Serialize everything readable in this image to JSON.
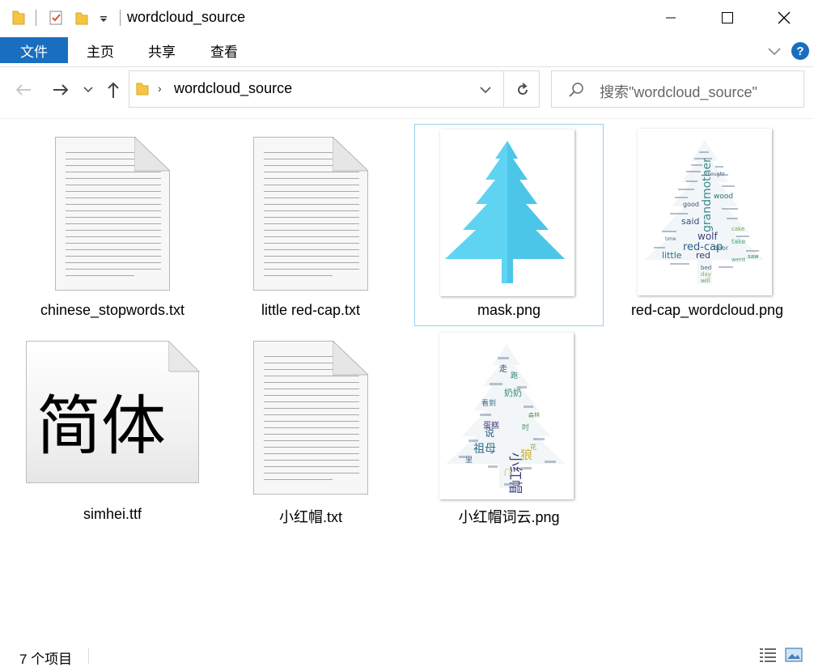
{
  "window": {
    "title": "wordcloud_source"
  },
  "ribbon": {
    "file_tab": "文件",
    "tabs": [
      "主页",
      "共享",
      "查看"
    ],
    "help_label": "?"
  },
  "address": {
    "path": "wordcloud_source",
    "separator": "›"
  },
  "search": {
    "placeholder": "搜索\"wordcloud_source\""
  },
  "files": [
    {
      "name": "chinese_stopwords.txt",
      "type": "text"
    },
    {
      "name": "little red-cap.txt",
      "type": "text"
    },
    {
      "name": "mask.png",
      "type": "image",
      "selected": true
    },
    {
      "name": "red-cap_wordcloud.png",
      "type": "image"
    },
    {
      "name": "simhei.ttf",
      "type": "font",
      "glyphs": "简体"
    },
    {
      "name": "小红帽.txt",
      "type": "text"
    },
    {
      "name": "小红帽词云.png",
      "type": "image"
    }
  ],
  "thumbnails": {
    "red_cap_words": [
      "grandmother",
      "red-cap",
      "wolf",
      "little",
      "red",
      "said",
      "wood",
      "good",
      "door",
      "take",
      "will",
      "bed",
      "day",
      "saw",
      "went",
      "cake",
      "thought",
      "time"
    ],
    "chinese_words": [
      "小红帽",
      "祖母",
      "狼",
      "奶奶",
      "说",
      "走",
      "跑",
      "蛋糕",
      "看到",
      "里",
      "时",
      "森林",
      "花",
      "门"
    ]
  },
  "status": {
    "item_count": "7 个项目"
  },
  "colors": {
    "accent": "#1a6ec0",
    "selection_border": "#99d1ef",
    "tree": "#5fd3f2"
  }
}
